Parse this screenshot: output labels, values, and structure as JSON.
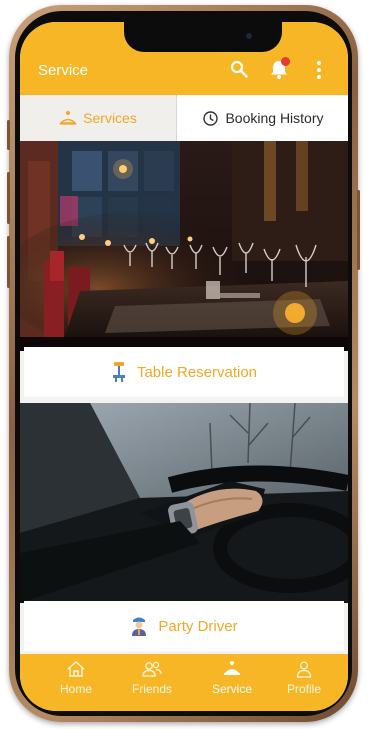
{
  "header": {
    "title": "Service"
  },
  "tabs": [
    {
      "label": "Services",
      "active": true,
      "icon": "services-icon"
    },
    {
      "label": "Booking History",
      "active": false,
      "icon": "history-icon"
    }
  ],
  "cards": [
    {
      "label": "Table Reservation",
      "icon": "table-reservation-icon",
      "image": "restaurant-interior-photo"
    },
    {
      "label": "Party Driver",
      "icon": "driver-icon",
      "image": "hand-on-steering-wheel-photo"
    }
  ],
  "bottom_nav": [
    {
      "label": "Home",
      "icon": "home-icon"
    },
    {
      "label": "Friends",
      "icon": "friends-icon"
    },
    {
      "label": "Service",
      "icon": "service-icon",
      "active": true
    },
    {
      "label": "Profile",
      "icon": "profile-icon"
    }
  ],
  "colors": {
    "accent": "#f7b626",
    "accent_text": "#f0a825",
    "badge": "#e53935"
  }
}
